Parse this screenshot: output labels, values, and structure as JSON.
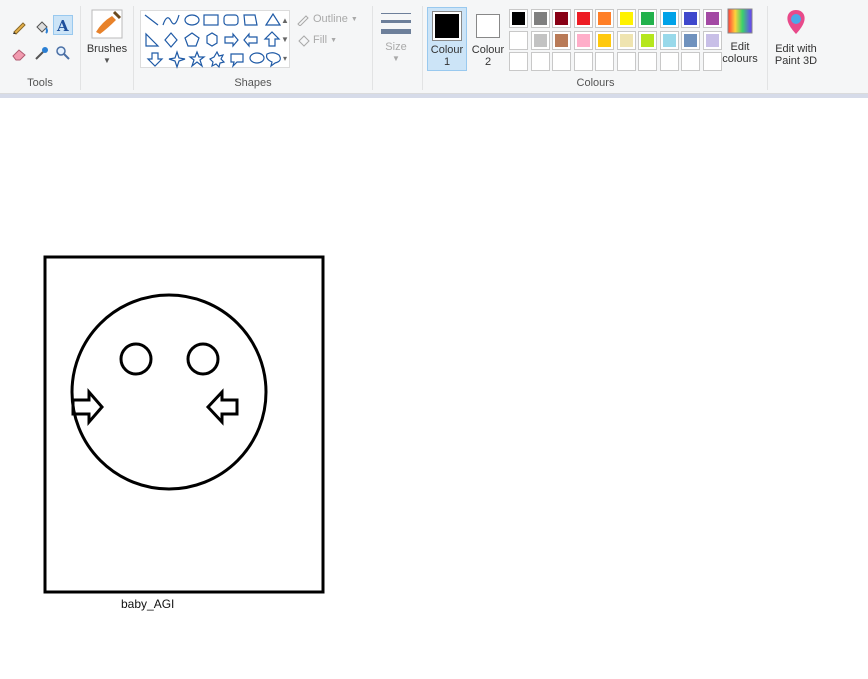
{
  "ribbon": {
    "groups": {
      "tools": "Tools",
      "shapes": "Shapes",
      "colours": "Colours"
    },
    "brushes_label": "Brushes",
    "outline_label": "Outline",
    "fill_label": "Fill",
    "size_label": "Size",
    "colour1_label_a": "Colour",
    "colour1_label_b": "1",
    "colour2_label_a": "Colour",
    "colour2_label_b": "2",
    "edit_colours_a": "Edit",
    "edit_colours_b": "colours",
    "paint3d_a": "Edit with",
    "paint3d_b": "Paint 3D",
    "colour1_value": "#000000",
    "colour2_value": "#ffffff",
    "palette_row1": [
      "#000000",
      "#7f7f7f",
      "#880015",
      "#ed1c24",
      "#ff7f27",
      "#fff200",
      "#22b14c",
      "#00a2e8",
      "#3f48cc",
      "#a349a4"
    ],
    "palette_row2": [
      "#ffffff",
      "#c3c3c3",
      "#b97a57",
      "#ffaec9",
      "#ffc90e",
      "#efe4b0",
      "#b5e61d",
      "#99d9ea",
      "#7092be",
      "#c8bfe7"
    ],
    "palette_row3": [
      "#ffffff",
      "#ffffff",
      "#ffffff",
      "#ffffff",
      "#ffffff",
      "#ffffff",
      "#ffffff",
      "#ffffff",
      "#ffffff",
      "#ffffff"
    ]
  },
  "canvas": {
    "caption": "baby_AGI"
  }
}
